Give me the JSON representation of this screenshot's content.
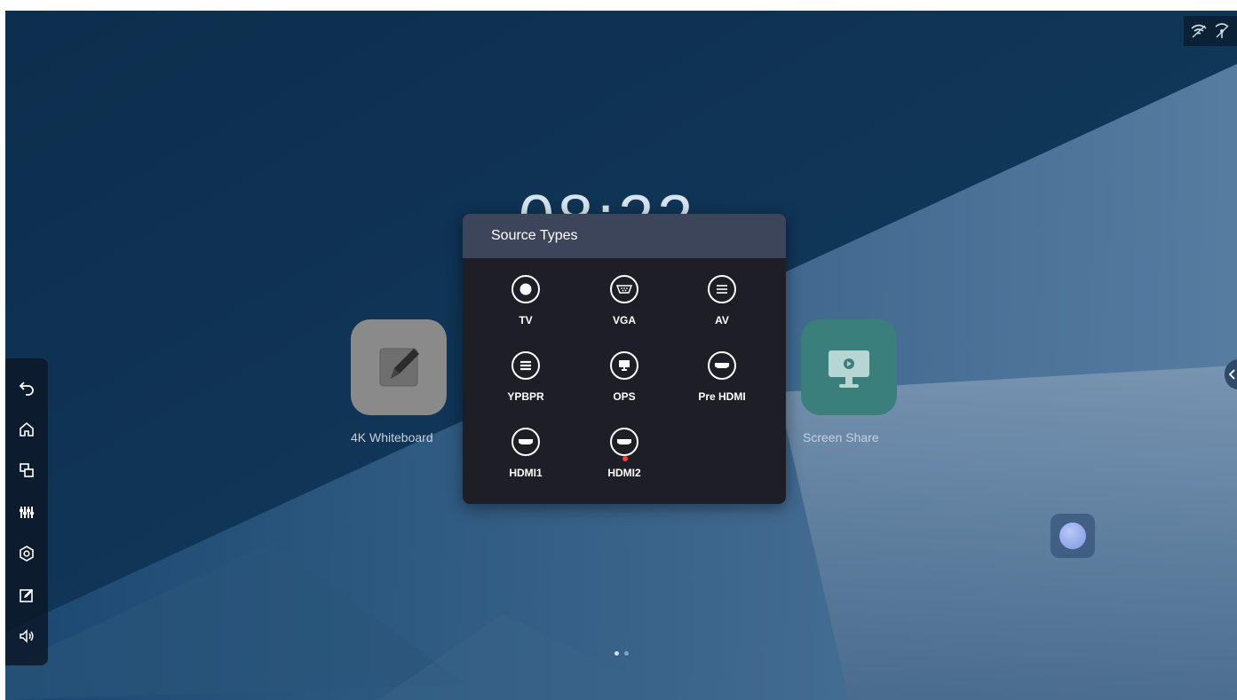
{
  "clock": {
    "time": "08:22"
  },
  "apps": [
    {
      "name": "4K Whiteboard",
      "icon": "pen-icon",
      "color": "#8a8a8a"
    },
    {
      "name": "Screen Share",
      "icon": "monitor-icon",
      "color": "#3a7f7c"
    }
  ],
  "source_panel": {
    "title": "Source Types",
    "sources": [
      {
        "label": "TV",
        "icon": "tv-radio-icon"
      },
      {
        "label": "VGA",
        "icon": "vga-icon"
      },
      {
        "label": "AV",
        "icon": "av-icon"
      },
      {
        "label": "YPBPR",
        "icon": "ypbpr-icon"
      },
      {
        "label": "OPS",
        "icon": "ops-icon"
      },
      {
        "label": "Pre HDMI",
        "icon": "hdmi-icon"
      },
      {
        "label": "HDMI1",
        "icon": "hdmi-icon"
      },
      {
        "label": "HDMI2",
        "icon": "hdmi-icon",
        "active": true
      }
    ]
  },
  "sidebar": {
    "items": [
      {
        "icon": "back-icon"
      },
      {
        "icon": "home-icon"
      },
      {
        "icon": "windows-icon"
      },
      {
        "icon": "equalizer-icon"
      },
      {
        "icon": "settings-icon"
      },
      {
        "icon": "annotate-icon"
      },
      {
        "icon": "volume-icon"
      }
    ]
  },
  "status": {
    "icons": [
      "wifi-icon",
      "hotspot-icon"
    ]
  },
  "colors": {
    "accent": "#3c4559",
    "active_indicator": "#ff3b3b"
  }
}
